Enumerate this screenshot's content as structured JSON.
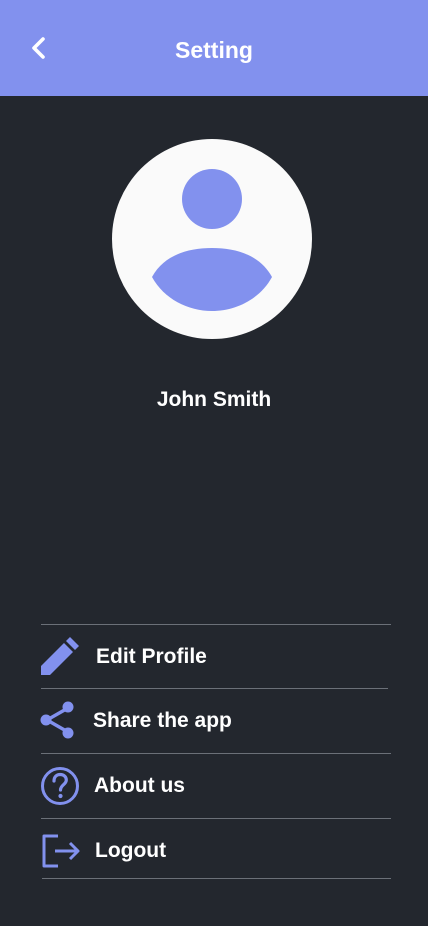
{
  "header": {
    "title": "Setting",
    "back_icon": "chevron-left-icon"
  },
  "profile": {
    "name": "John Smith",
    "avatar_icon": "user-avatar-icon"
  },
  "menu": {
    "items": [
      {
        "label": "Edit Profile",
        "icon": "pencil-icon"
      },
      {
        "label": "Share the app",
        "icon": "share-icon"
      },
      {
        "label": "About us",
        "icon": "help-circle-icon"
      },
      {
        "label": "Logout",
        "icon": "logout-icon"
      }
    ]
  },
  "colors": {
    "accent": "#8291ee",
    "background": "#23272e",
    "avatar_bg": "#fafafa",
    "divider": "#6b7078",
    "text": "#ffffff"
  }
}
